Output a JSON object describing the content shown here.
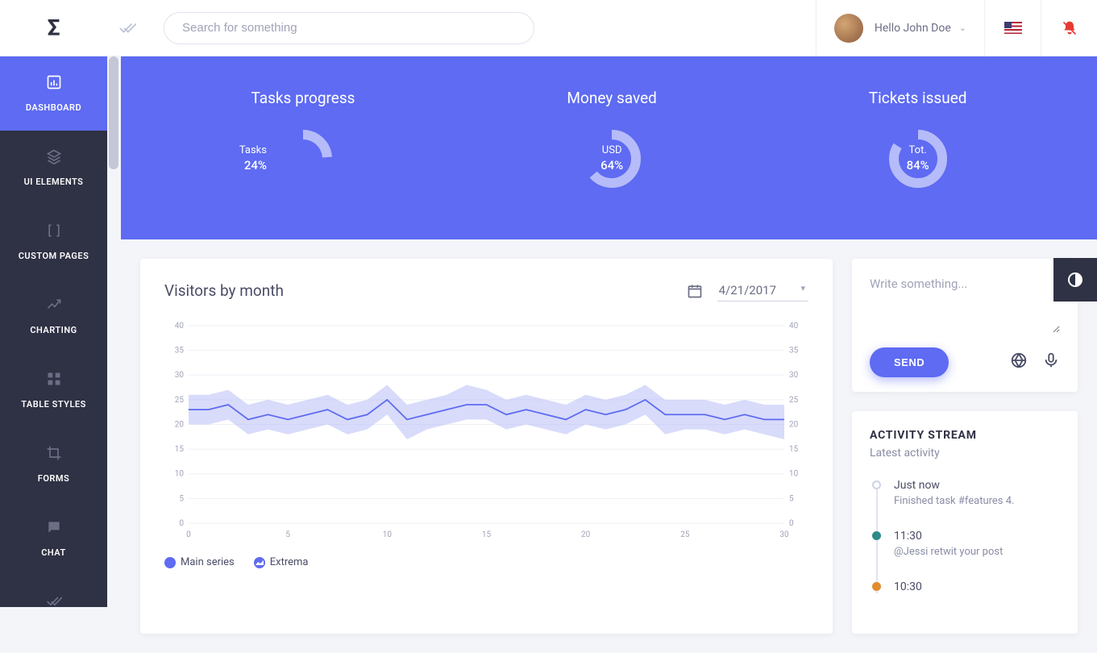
{
  "header": {
    "search_placeholder": "Search for something",
    "user_greeting": "Hello John Doe"
  },
  "sidebar": {
    "items": [
      {
        "label": "DASHBOARD",
        "icon": "bar-chart"
      },
      {
        "label": "UI ELEMENTS",
        "icon": "layers"
      },
      {
        "label": "CUSTOM PAGES",
        "icon": "brackets"
      },
      {
        "label": "CHARTING",
        "icon": "trend"
      },
      {
        "label": "TABLE STYLES",
        "icon": "grid"
      },
      {
        "label": "FORMS",
        "icon": "crop"
      },
      {
        "label": "CHAT",
        "icon": "chat"
      }
    ]
  },
  "hero": {
    "cards": [
      {
        "title": "Tasks progress",
        "label": "Tasks",
        "value": "24%",
        "pct": 24
      },
      {
        "title": "Money saved",
        "label": "USD",
        "value": "64%",
        "pct": 64
      },
      {
        "title": "Tickets issued",
        "label": "Tot.",
        "value": "84%",
        "pct": 84
      }
    ]
  },
  "chart": {
    "title": "Visitors by month",
    "date": "4/21/2017",
    "legend": [
      {
        "label": "Main series",
        "color": "#5e6bf2"
      },
      {
        "label": "Extrema",
        "color": "#5e6bf2"
      }
    ]
  },
  "chart_data": {
    "type": "line",
    "title": "Visitors by month",
    "xlabel": "",
    "ylabel": "",
    "xlim": [
      0,
      30
    ],
    "ylim": [
      0,
      40
    ],
    "y_ticks": [
      0,
      5,
      10,
      15,
      20,
      25,
      30,
      35,
      40
    ],
    "x_ticks": [
      0,
      5,
      10,
      15,
      20,
      25,
      30
    ],
    "series": [
      {
        "name": "Main series",
        "x": [
          0,
          1,
          2,
          3,
          4,
          5,
          6,
          7,
          8,
          9,
          10,
          11,
          12,
          13,
          14,
          15,
          16,
          17,
          18,
          19,
          20,
          21,
          22,
          23,
          24,
          25,
          26,
          27,
          28,
          29,
          30
        ],
        "y": [
          23,
          23,
          24,
          21,
          22,
          21,
          22,
          23,
          21,
          22,
          25,
          21,
          22,
          23,
          24,
          24,
          22,
          23,
          22,
          21,
          23,
          22,
          23,
          25,
          22,
          22,
          22,
          21,
          22,
          21,
          21
        ]
      },
      {
        "name": "Extrema upper",
        "x": [
          0,
          1,
          2,
          3,
          4,
          5,
          6,
          7,
          8,
          9,
          10,
          11,
          12,
          13,
          14,
          15,
          16,
          17,
          18,
          19,
          20,
          21,
          22,
          23,
          24,
          25,
          26,
          27,
          28,
          29,
          30
        ],
        "y": [
          26,
          26,
          27,
          24,
          25,
          24,
          25,
          26,
          24,
          25,
          28,
          24,
          25,
          26,
          28,
          27,
          25,
          26,
          25,
          24,
          26,
          25,
          26,
          28,
          25,
          25,
          25,
          24,
          25,
          24,
          24
        ]
      },
      {
        "name": "Extrema lower",
        "x": [
          0,
          1,
          2,
          3,
          4,
          5,
          6,
          7,
          8,
          9,
          10,
          11,
          12,
          13,
          14,
          15,
          16,
          17,
          18,
          19,
          20,
          21,
          22,
          23,
          24,
          25,
          26,
          27,
          28,
          29,
          30
        ],
        "y": [
          20,
          20,
          21,
          18,
          19,
          18,
          19,
          20,
          18,
          19,
          22,
          17,
          19,
          20,
          21,
          21,
          19,
          20,
          19,
          18,
          20,
          19,
          20,
          22,
          18,
          19,
          19,
          18,
          19,
          18,
          17
        ]
      }
    ]
  },
  "compose": {
    "placeholder": "Write something...",
    "send_label": "SEND"
  },
  "activity": {
    "title": "ACTIVITY STREAM",
    "subtitle": "Latest activity",
    "items": [
      {
        "time": "Just now",
        "text": "Finished task #features 4.",
        "dot": ""
      },
      {
        "time": "11:30",
        "text": "@Jessi retwit your post",
        "dot": "teal"
      },
      {
        "time": "10:30",
        "text": "",
        "dot": "orange"
      }
    ]
  }
}
